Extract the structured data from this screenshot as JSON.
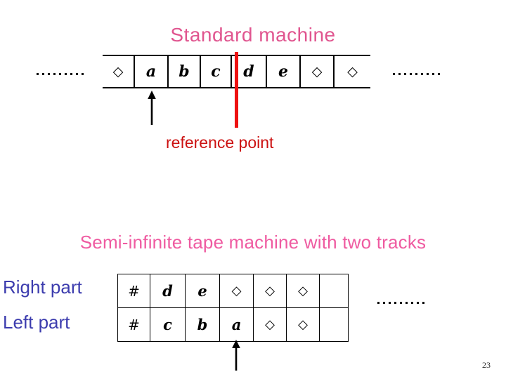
{
  "slide": {
    "page_number": "23"
  },
  "standard_machine": {
    "title": "Standard machine",
    "left_ellipsis": ". . . . . . . . .",
    "right_ellipsis": ". . . . . . . . .",
    "tape_cells": [
      "◇",
      "a",
      "b",
      "c",
      "d",
      "e",
      "◇",
      "◇"
    ],
    "head_cell_index": 1,
    "reference_point": {
      "label": "reference point",
      "color": "#cc1111",
      "between_cell_index": 4
    }
  },
  "semi_infinite_machine": {
    "title": "Semi-infinite tape machine with two tracks",
    "right_ellipsis": ". . . . . . . . .",
    "row_labels": [
      "Right part",
      "Left part"
    ],
    "rows": [
      {
        "name": "Right part",
        "cells": [
          "#",
          "d",
          "e",
          "◇",
          "◇",
          "◇",
          ""
        ]
      },
      {
        "name": "Left part",
        "cells": [
          "#",
          "c",
          "b",
          "a",
          "◇",
          "◇",
          ""
        ]
      }
    ],
    "head_cell_index": 3
  },
  "colors": {
    "title_pink": "#e0558f",
    "title_pink2": "#ef5ba1",
    "reference_red": "#ee1111",
    "label_blue": "#3c3cae",
    "tape_black": "#000000"
  }
}
